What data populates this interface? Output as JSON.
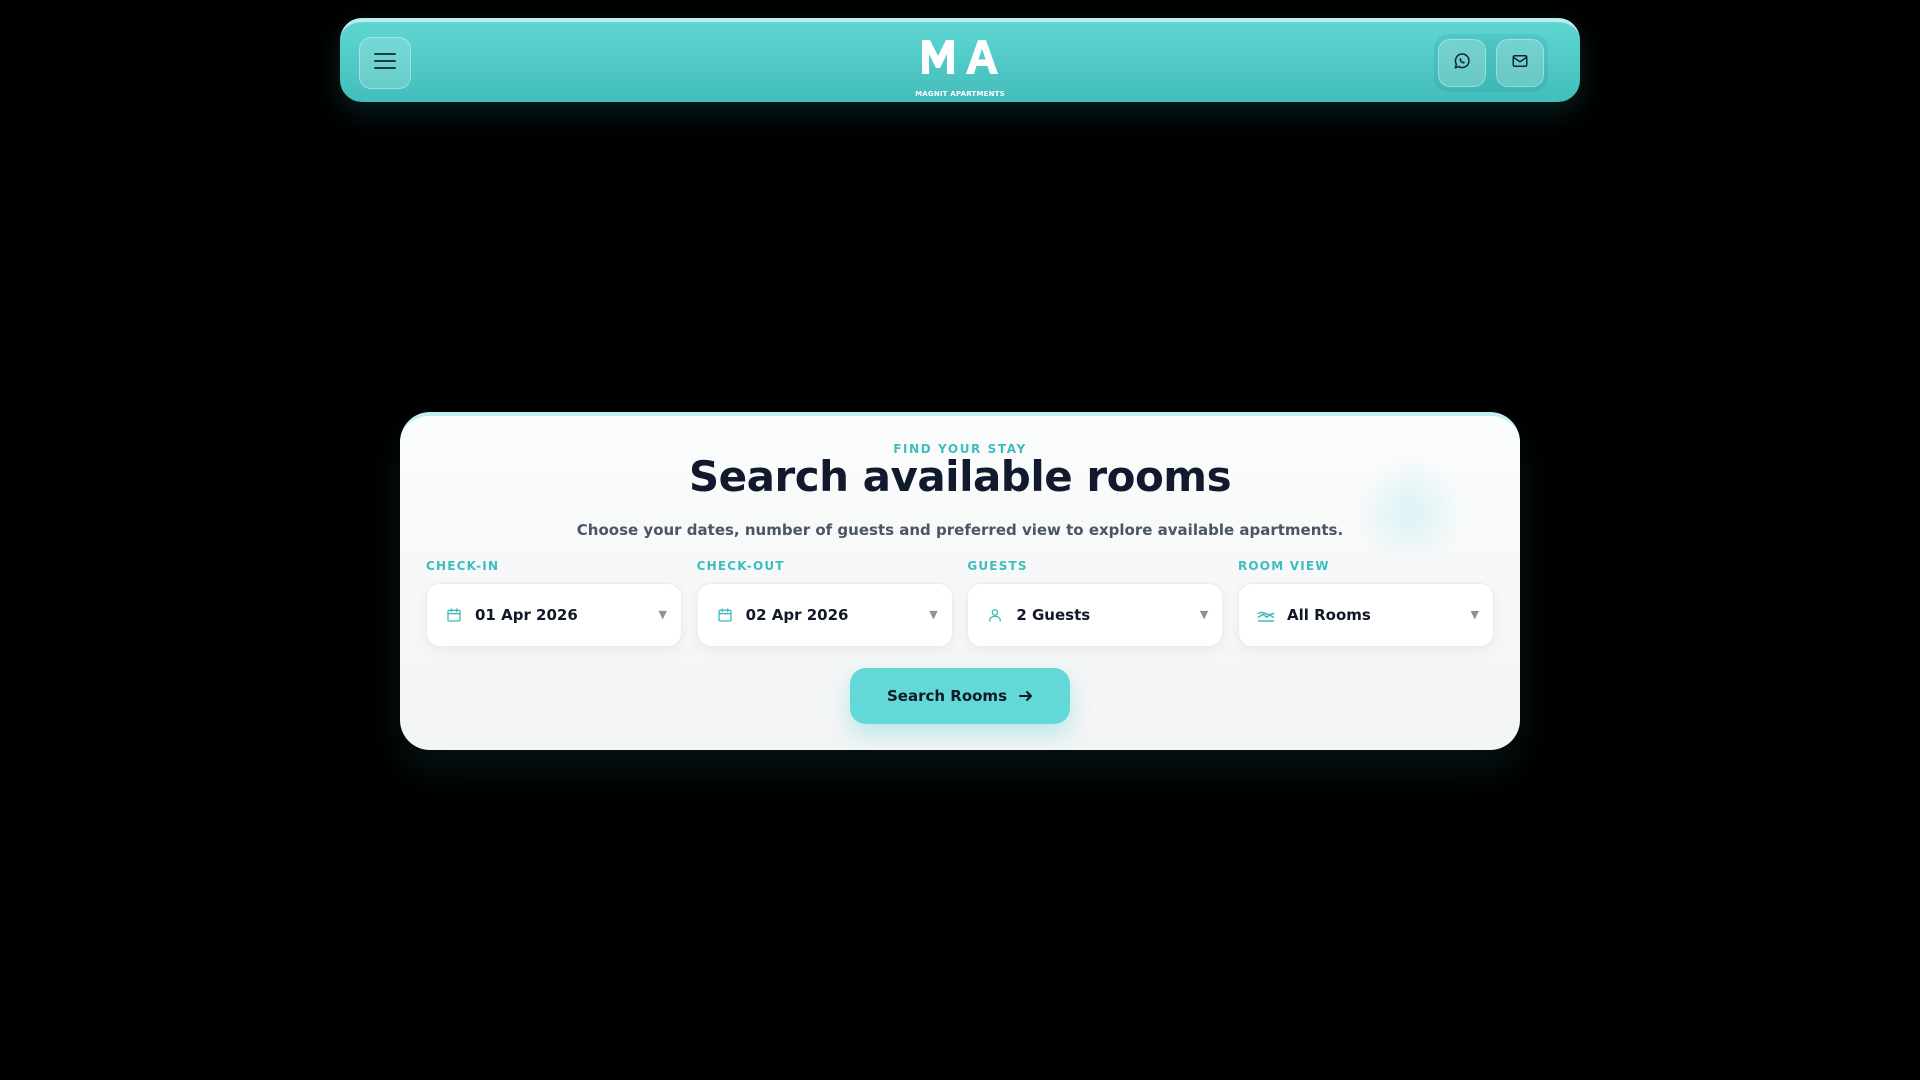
{
  "header": {
    "logo_letters": "MA",
    "logo_subtitle": "MAGNIT APARTMENTS",
    "menu_icon": "hamburger-icon",
    "contact_icons": [
      "whatsapp-icon",
      "mail-icon"
    ]
  },
  "search": {
    "eyebrow": "FIND YOUR STAY",
    "title": "Search available rooms",
    "subtitle": "Choose your dates, number of guests and preferred view to explore available apartments.",
    "fields": [
      {
        "label": "CHECK-IN",
        "value": "01 Apr 2026",
        "icon": "calendar-icon"
      },
      {
        "label": "CHECK-OUT",
        "value": "02 Apr 2026",
        "icon": "calendar-icon"
      },
      {
        "label": "GUESTS",
        "value": "2 Guests",
        "icon": "user-icon"
      },
      {
        "label": "ROOM VIEW",
        "value": "All Rooms",
        "icon": "landscape-icon"
      }
    ],
    "button_label": "Search Rooms"
  },
  "colors": {
    "accent": "#3fbcbc",
    "header_bg": "#4cc7c5",
    "button_bg": "#62d8d7",
    "title_text": "#101a2c",
    "page_bg": "#000000"
  }
}
